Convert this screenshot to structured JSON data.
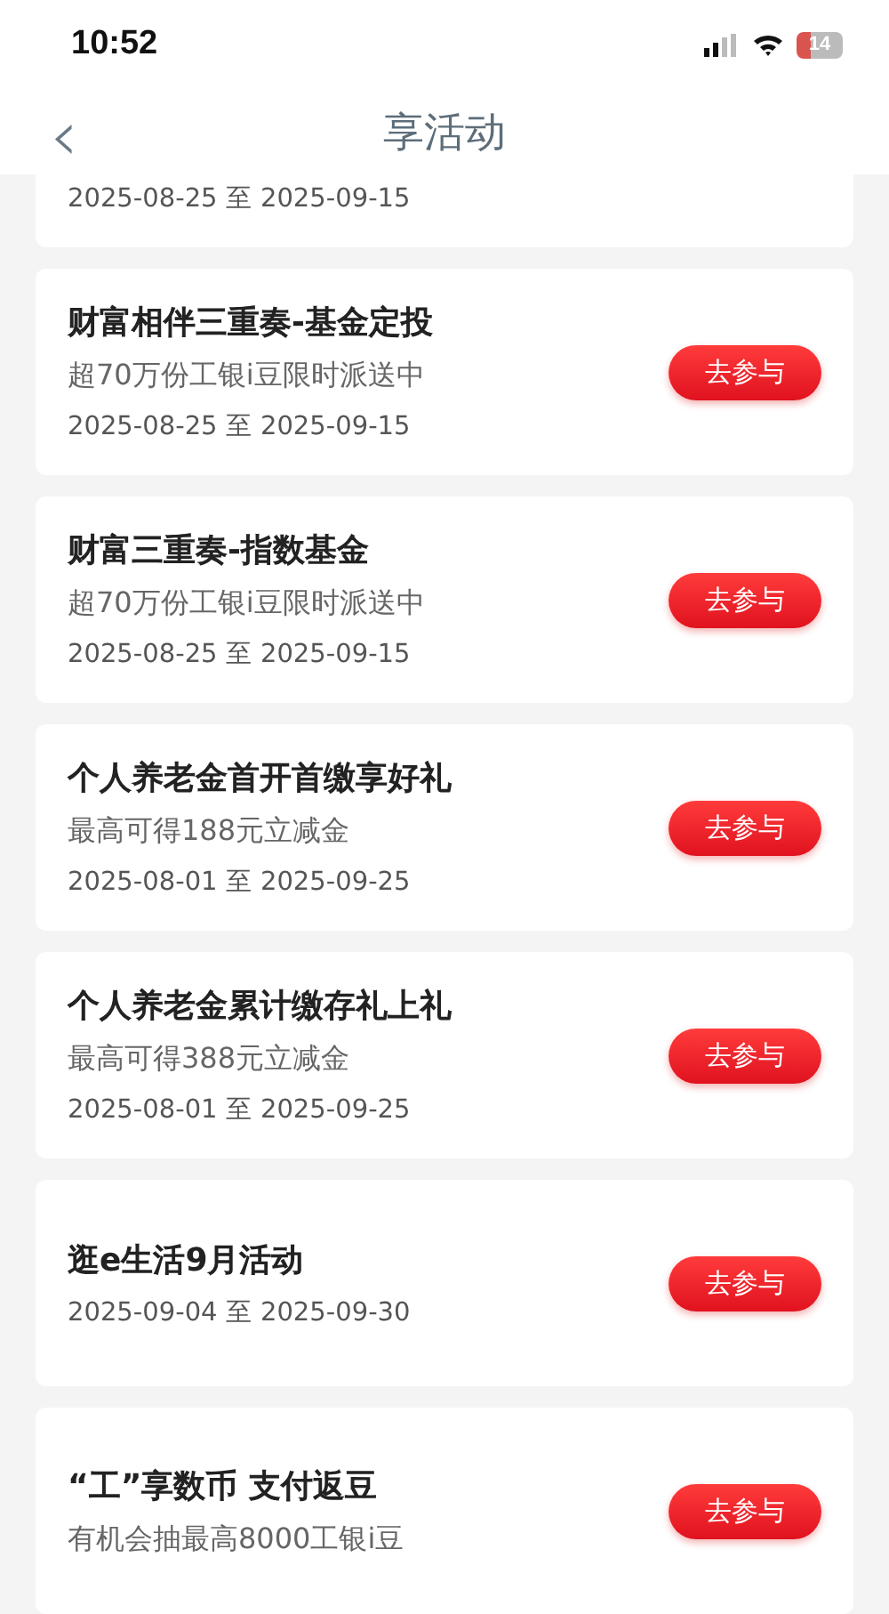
{
  "status_bar": {
    "time": "10:52",
    "battery": "14"
  },
  "nav": {
    "back": "‹",
    "title": "享活动"
  },
  "activities": [
    {
      "date": "2025-08-25 至 2025-09-15"
    },
    {
      "title": "财富相伴三重奏-基金定投",
      "subtitle": "超70万份工银i豆限时派送中",
      "date": "2025-08-25 至 2025-09-15",
      "action": "去参与"
    },
    {
      "title": "财富三重奏-指数基金",
      "subtitle": "超70万份工银i豆限时派送中",
      "date": "2025-08-25 至 2025-09-15",
      "action": "去参与"
    },
    {
      "title": "个人养老金首开首缴享好礼",
      "subtitle": "最高可得188元立减金",
      "date": "2025-08-01 至 2025-09-25",
      "action": "去参与"
    },
    {
      "title": "个人养老金累计缴存礼上礼",
      "subtitle": "最高可得388元立减金",
      "date": "2025-08-01 至 2025-09-25",
      "action": "去参与"
    },
    {
      "title": "逛e生活9月活动",
      "date": "2025-09-04 至 2025-09-30",
      "action": "去参与"
    },
    {
      "title": "“工”享数币 支付返豆",
      "subtitle": "有机会抽最高8000工银i豆",
      "action": "去参与"
    }
  ]
}
